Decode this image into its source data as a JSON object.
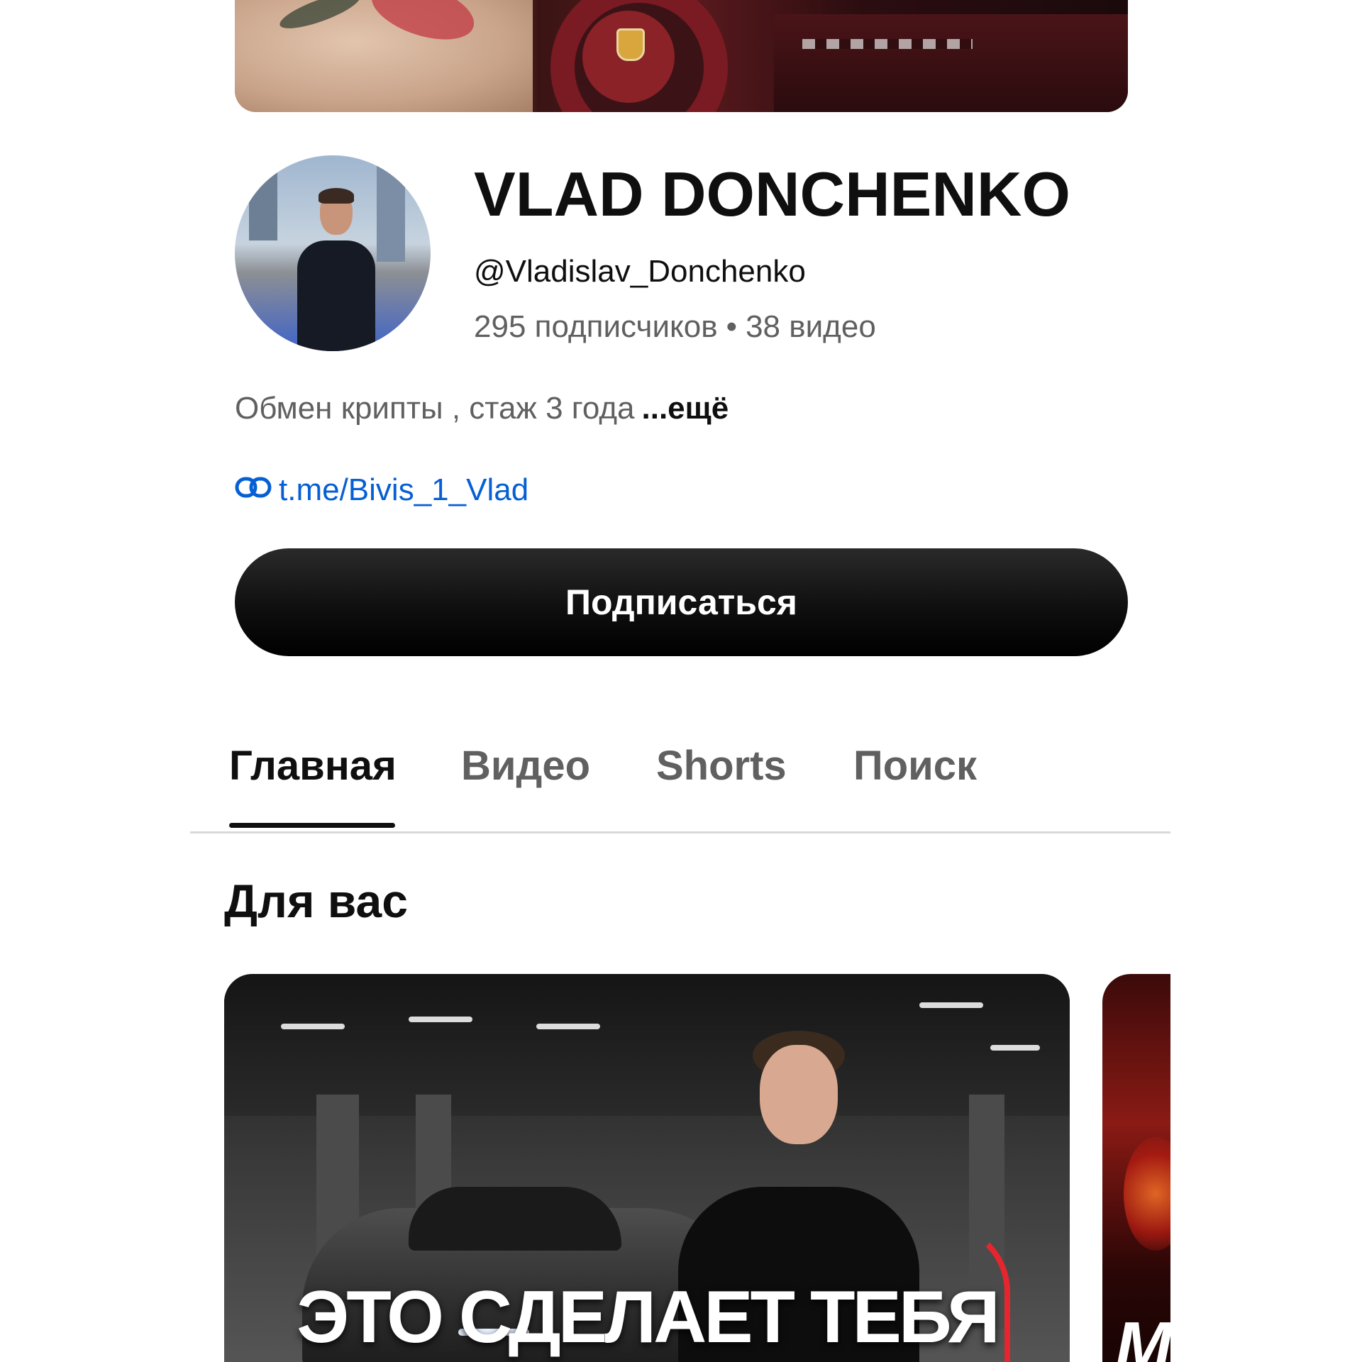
{
  "channel": {
    "name": "VLAD DONCHENKO",
    "handle": "@Vladislav_Donchenko",
    "subscribers": "295 подписчиков",
    "separator": "•",
    "videos": "38 видео",
    "description": "Обмен крипты , стаж 3 года",
    "more_label": "...ещё",
    "link": "t.me/Bivis_1_Vlad"
  },
  "subscribe_button": {
    "label": "Подписаться"
  },
  "tabs": [
    {
      "label": "Главная",
      "active": true
    },
    {
      "label": "Видео",
      "active": false
    },
    {
      "label": "Shorts",
      "active": false
    },
    {
      "label": "Поиск",
      "active": false
    }
  ],
  "section": {
    "title": "Для вас"
  },
  "videos": [
    {
      "thumbnail_text": "ЭТО СДЕЛАЕТ ТЕБЯ"
    },
    {
      "thumbnail_text": "M"
    }
  ],
  "colors": {
    "link": "#065fd4",
    "secondary_text": "#606060",
    "primary_text": "#0f0f0f",
    "button_bg": "#0f0f0f"
  },
  "icons": {
    "link": "link-icon"
  }
}
